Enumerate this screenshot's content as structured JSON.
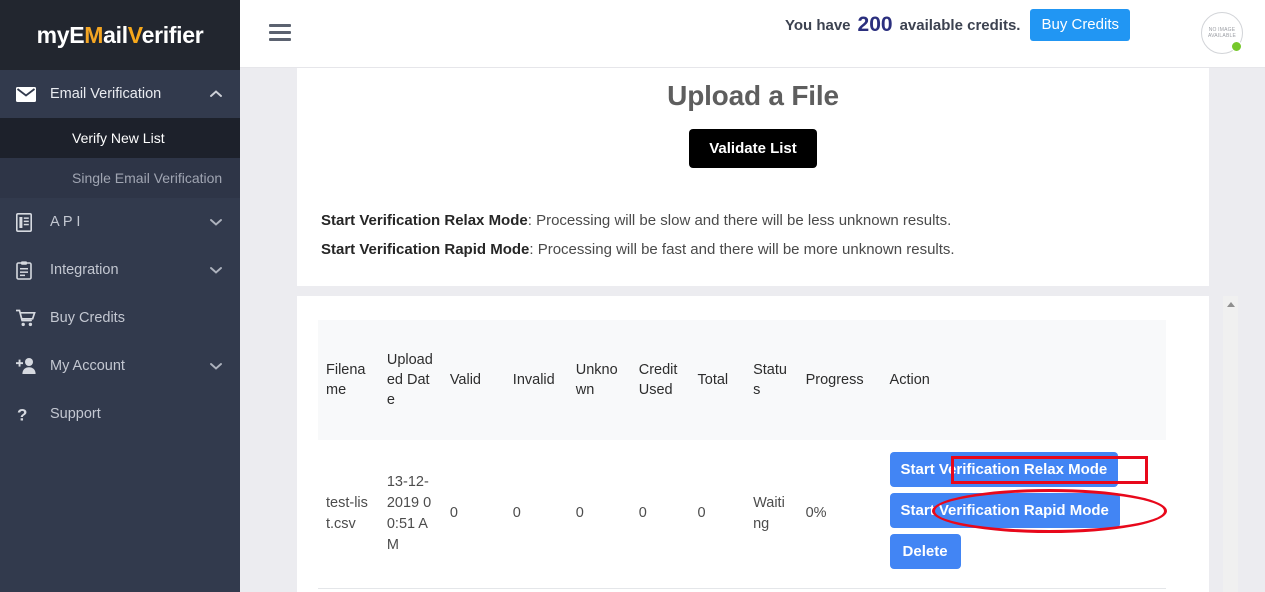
{
  "sidebar": {
    "logo": {
      "part1": "myE",
      "part2": "M",
      "part3": "ail",
      "part4": "V",
      "part5": "erifier"
    },
    "items": [
      {
        "label": "Email Verification",
        "icon": "envelope-icon",
        "expanded": true
      },
      {
        "label": "A P I",
        "icon": "document-icon",
        "expanded": false
      },
      {
        "label": "Integration",
        "icon": "clipboard-icon",
        "expanded": false
      },
      {
        "label": "Buy Credits",
        "icon": "cart-icon",
        "expanded": null
      },
      {
        "label": "My Account",
        "icon": "add-user-icon",
        "expanded": false
      },
      {
        "label": "Support",
        "icon": "question-icon",
        "expanded": null
      }
    ],
    "subitems": [
      {
        "label": "Verify New List",
        "active": true
      },
      {
        "label": "Single Email Verification",
        "active": false
      }
    ]
  },
  "topbar": {
    "menu_icon": "hamburger-icon",
    "credits_prefix": "You have",
    "credits_count": "200",
    "credits_suffix": "available credits.",
    "buy_credits_label": "Buy Credits",
    "avatar_line1": "NO IMAGE",
    "avatar_line2": "AVAILABLE",
    "status_dot_color": "#76c82b"
  },
  "main": {
    "title": "Upload a File",
    "validate_label": "Validate List",
    "notes": [
      {
        "strong": "Start Verification Relax Mode",
        "rest": ": Processing will be slow and there will be less unknown results."
      },
      {
        "strong": "Start Verification Rapid Mode",
        "rest": ": Processing will be fast and there will be more unknown results."
      }
    ]
  },
  "table": {
    "headers": [
      "Filename",
      "Uploaded Date",
      "Valid",
      "Invalid",
      "Unknown",
      "Credit Used",
      "Total",
      "Status",
      "Progress",
      "Action"
    ],
    "rows": [
      {
        "filename": "test-list.csv",
        "uploaded_date": "13-12-2019 00:51 AM",
        "valid": "0",
        "invalid": "0",
        "unknown": "0",
        "credit_used": "0",
        "total": "0",
        "status": "Waiting",
        "progress": "0%",
        "actions": [
          {
            "label": "Start Verification Relax Mode",
            "name": "start-relax-mode-button"
          },
          {
            "label": "Start Verification Rapid Mode",
            "name": "start-rapid-mode-button"
          },
          {
            "label": "Delete",
            "name": "delete-button"
          }
        ]
      }
    ]
  },
  "colors": {
    "accent_blue": "#2196f3",
    "action_blue": "#4285f4",
    "sidebar_bg": "#323a4d",
    "logo_accent": "#f5a623",
    "annotation_red": "#e8081b"
  }
}
